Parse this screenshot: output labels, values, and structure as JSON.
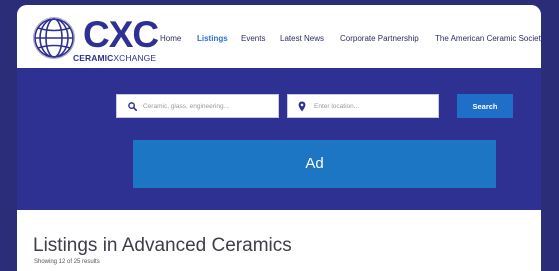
{
  "logo": {
    "mark": "CXC",
    "sub_bold": "CERAMIC",
    "sub_regular": "XCHANGE"
  },
  "nav": {
    "items": [
      {
        "label": "Home",
        "active": false
      },
      {
        "label": "Listings",
        "active": true
      },
      {
        "label": "Events",
        "active": false
      },
      {
        "label": "Latest News",
        "active": false
      },
      {
        "label": "Corporate Partnership",
        "active": false
      },
      {
        "label": "The American Ceramic Society",
        "active": false
      }
    ]
  },
  "search": {
    "keyword_placeholder": "Ceramic, glass, engineering...",
    "location_placeholder": "Enter location...",
    "button_label": "Search",
    "keyword_icon": "search-icon",
    "location_icon": "map-pin-icon"
  },
  "ad": {
    "label": "Ad"
  },
  "listings": {
    "title": "Listings in Advanced Ceramics",
    "count": "Showing 12 of 25 results"
  },
  "colors": {
    "brand_navy": "#2e3192",
    "outer_background": "#2b2d78",
    "active_link": "#2a6fdb",
    "button_blue": "#1f6fc9",
    "ad_blue": "#1c76c4"
  }
}
